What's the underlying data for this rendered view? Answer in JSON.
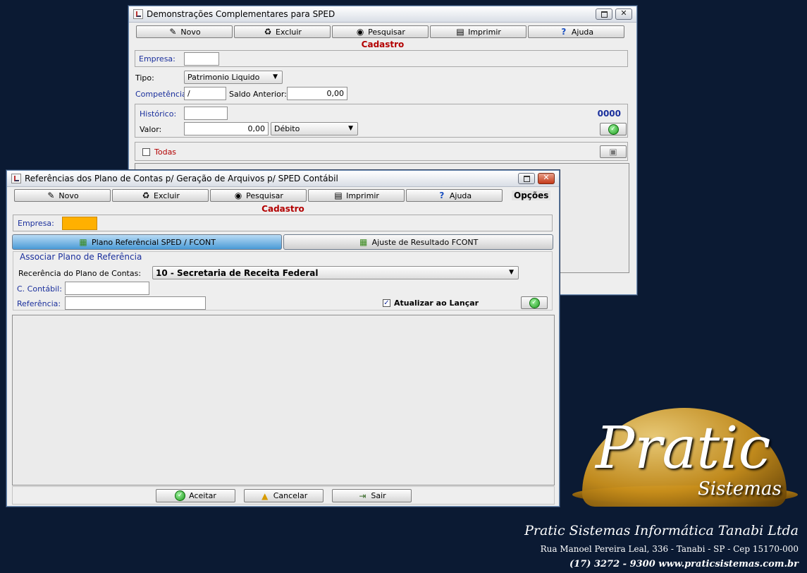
{
  "back_window": {
    "title": "Demonstrações Complementares para SPED",
    "toolbar": [
      {
        "label": "Novo",
        "icon": "pencil-icon"
      },
      {
        "label": "Excluir",
        "icon": "trash-icon"
      },
      {
        "label": "Pesquisar",
        "icon": "binoculars-icon"
      },
      {
        "label": "Imprimir",
        "icon": "printer-icon"
      },
      {
        "label": "Ajuda",
        "icon": "help-icon"
      }
    ],
    "section_title": "Cadastro",
    "empresa_label": "Empresa:",
    "empresa_value": "",
    "tipo_label": "Tipo:",
    "tipo_value": "Patrimonio Liquido",
    "competencia_label": "Competência:",
    "competencia_value": "/",
    "saldo_label": "Saldo Anterior:",
    "saldo_value": "0,00",
    "historico_label": "Histórico:",
    "historico_value": "",
    "counter": "0000",
    "valor_label": "Valor:",
    "valor_value": "0,00",
    "debito_value": "Débito",
    "todas_label": "Todas"
  },
  "front_window": {
    "title": "Referências dos Plano de Contas p/ Geração de Arquivos p/ SPED Contábil",
    "toolbar": [
      {
        "label": "Novo",
        "icon": "pencil-icon"
      },
      {
        "label": "Excluir",
        "icon": "trash-icon"
      },
      {
        "label": "Pesquisar",
        "icon": "binoculars-icon"
      },
      {
        "label": "Imprimir",
        "icon": "printer-icon"
      },
      {
        "label": "Ajuda",
        "icon": "help-icon"
      }
    ],
    "opcoes_label": "Opções",
    "section_title": "Cadastro",
    "empresa_label": "Empresa:",
    "empresa_value": "",
    "tabs": [
      {
        "label": "Plano Referêncial SPED / FCONT",
        "active": true
      },
      {
        "label": "Ajuste de Resultado FCONT",
        "active": false
      }
    ],
    "group_title": "Associar Plano de Referência",
    "recerencia_label": "Recerência do Plano de Contas:",
    "recerencia_value": "10 - Secretaria de Receita Federal",
    "c_contabil_label": "C. Contábil:",
    "c_contabil_value": "",
    "referencia_label": "Referência:",
    "referencia_value": "",
    "atualizar_label": "Atualizar ao Lançar",
    "atualizar_checked": true,
    "bottom_buttons": [
      {
        "label": "Aceitar",
        "icon": "check-icon"
      },
      {
        "label": "Cancelar",
        "icon": "warning-icon"
      },
      {
        "label": "Sair",
        "icon": "exit-icon"
      }
    ]
  },
  "branding": {
    "logo_word": "Pratic",
    "logo_sub": "Sistemas",
    "company": "Pratic Sistemas Informática Tanabi Ltda",
    "address": "Rua Manoel Pereira Leal, 336 - Tanabi - SP - Cep 15170-000",
    "contact": "(17) 3272 - 9300  www.praticsistemas.com.br"
  },
  "colors": {
    "desktop": "#0b1a33",
    "accent_red": "#b30000",
    "label_blue": "#1a2f9c",
    "empresa_highlight": "#ffb000"
  }
}
